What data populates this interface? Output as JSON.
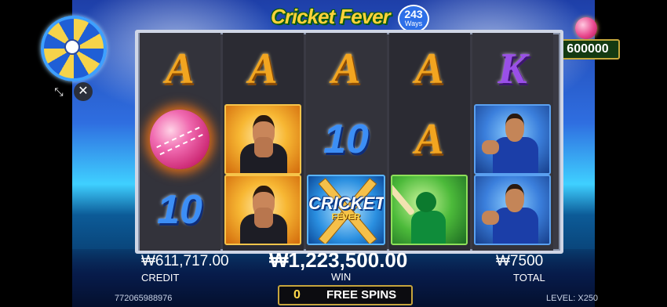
{
  "game": {
    "logo_text": "Cricket Fever",
    "ways_number": "243",
    "ways_label": "Ways"
  },
  "jackpot": {
    "value": "600000"
  },
  "controls": {
    "collapse_glyph": "⤡",
    "close_glyph": "✕"
  },
  "reels": [
    [
      {
        "type": "A",
        "text": "A"
      },
      {
        "type": "ball"
      },
      {
        "type": "10",
        "text": "10"
      }
    ],
    [
      {
        "type": "A",
        "text": "A"
      },
      {
        "type": "player"
      },
      {
        "type": "player"
      }
    ],
    [
      {
        "type": "A",
        "text": "A"
      },
      {
        "type": "10",
        "text": "10"
      },
      {
        "type": "wild",
        "text": "CRICKET",
        "sub": "FEVER"
      }
    ],
    [
      {
        "type": "A",
        "text": "A"
      },
      {
        "type": "A",
        "text": "A"
      },
      {
        "type": "batsman"
      }
    ],
    [
      {
        "type": "K",
        "text": "K"
      },
      {
        "type": "bowler"
      },
      {
        "type": "bowler"
      }
    ]
  ],
  "stats": {
    "credit_value": "₩611,717.00",
    "credit_label": "CREDIT",
    "win_value": "₩1,223,500.00",
    "win_label": "WIN",
    "total_value": "₩7500",
    "total_label": "TOTAL"
  },
  "free_spins": {
    "count": "0",
    "label": "FREE SPINS"
  },
  "footer": {
    "session_id": "772065988976",
    "level": "LEVEL: X250"
  }
}
